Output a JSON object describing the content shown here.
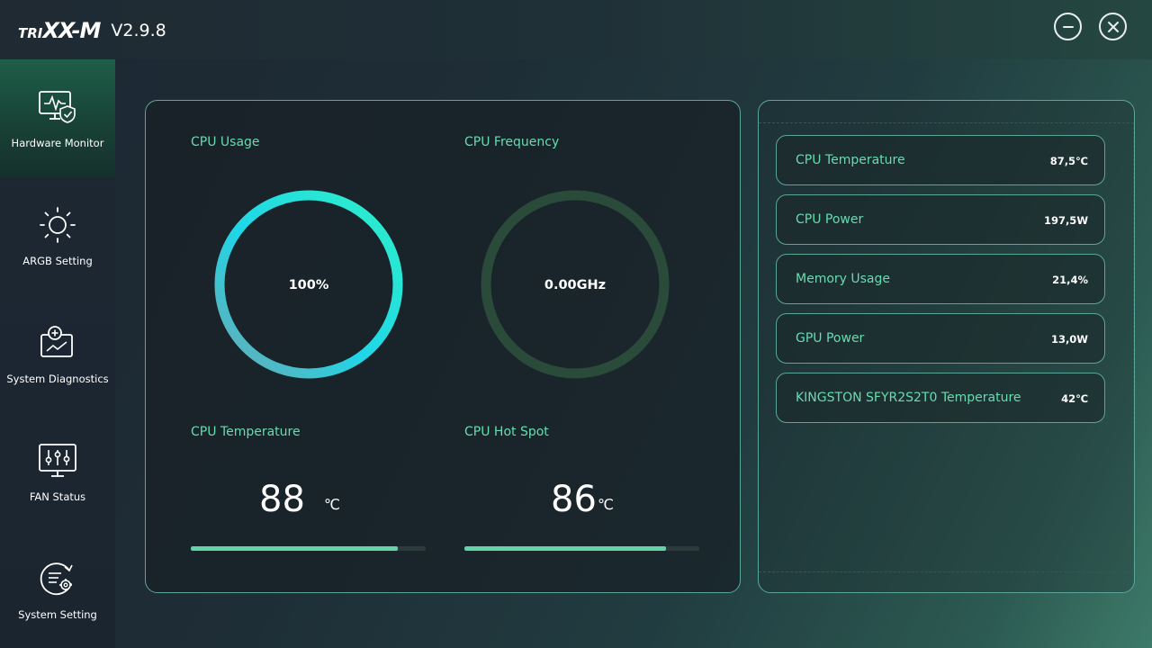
{
  "app": {
    "logo_text_1": "TRI",
    "logo_text_2": "XX",
    "logo_text_3": "-M",
    "version": "V2.9.8"
  },
  "sidebar": {
    "items": [
      {
        "label": "Hardware Monitor",
        "icon": "hardware-monitor-icon",
        "active": true
      },
      {
        "label": "ARGB Setting",
        "icon": "sun-icon",
        "active": false
      },
      {
        "label": "System Diagnostics",
        "icon": "diagnostics-icon",
        "active": false
      },
      {
        "label": "FAN Status",
        "icon": "fan-sliders-icon",
        "active": false
      },
      {
        "label": "System Setting",
        "icon": "settings-icon",
        "active": false
      }
    ]
  },
  "monitor": {
    "cpu_usage": {
      "label": "CPU Usage",
      "display": "100%",
      "percent": 100
    },
    "cpu_frequency": {
      "label": "CPU Frequency",
      "display": "0.00GHz",
      "percent": 0
    },
    "cpu_temperature": {
      "label": "CPU Temperature",
      "value": "88",
      "unit": "℃",
      "fill_fraction": 0.88
    },
    "cpu_hotspot": {
      "label": "CPU Hot Spot",
      "value": "86",
      "unit": "℃",
      "fill_fraction": 0.86
    }
  },
  "stats": [
    {
      "name": "CPU Temperature",
      "value": "87,5℃"
    },
    {
      "name": "CPU Power",
      "value": "197,5W"
    },
    {
      "name": "Memory Usage",
      "value": "21,4%"
    },
    {
      "name": "GPU Power",
      "value": "13,0W"
    },
    {
      "name": "KINGSTON SFYR2S2T0 Temperature",
      "value": "42℃"
    }
  ],
  "colors": {
    "accent_green": "#66dcb0",
    "gauge_cyan": "#1fd6e8",
    "gauge_teal": "#2ef0c8",
    "gauge_track_idle": "#2a4a3a",
    "panel_border": "#5aa79a"
  }
}
